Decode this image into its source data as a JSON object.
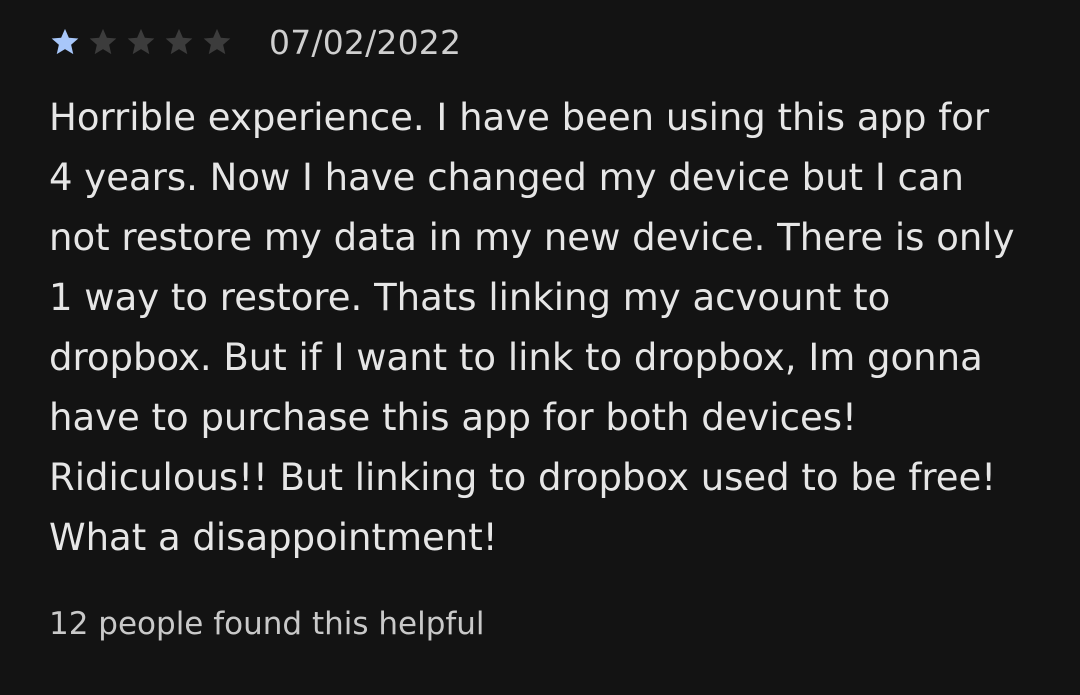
{
  "review": {
    "rating": 1,
    "max_rating": 5,
    "date": "07/02/2022",
    "body_lines": [
      "Horrible experience. I have been using this app for",
      "4 years. Now I have changed my device but I can",
      "not restore my data in my new device. There is only",
      "1 way to restore. Thats linking my acvount to",
      "dropbox. But if I want to link to dropbox, Im gonna",
      "have to purchase this app for both devices!",
      "Ridiculous!! But linking to dropbox used to be free!",
      "What a disappointment!"
    ],
    "helpful_text": "12 people found this helpful"
  },
  "colors": {
    "background": "#131313",
    "star_filled": "#a8c7fa",
    "star_empty": "#3c3c3c",
    "text": "#e6e6e6"
  },
  "icons": {
    "star_filled": "star-filled-icon",
    "star_empty": "star-empty-icon"
  }
}
